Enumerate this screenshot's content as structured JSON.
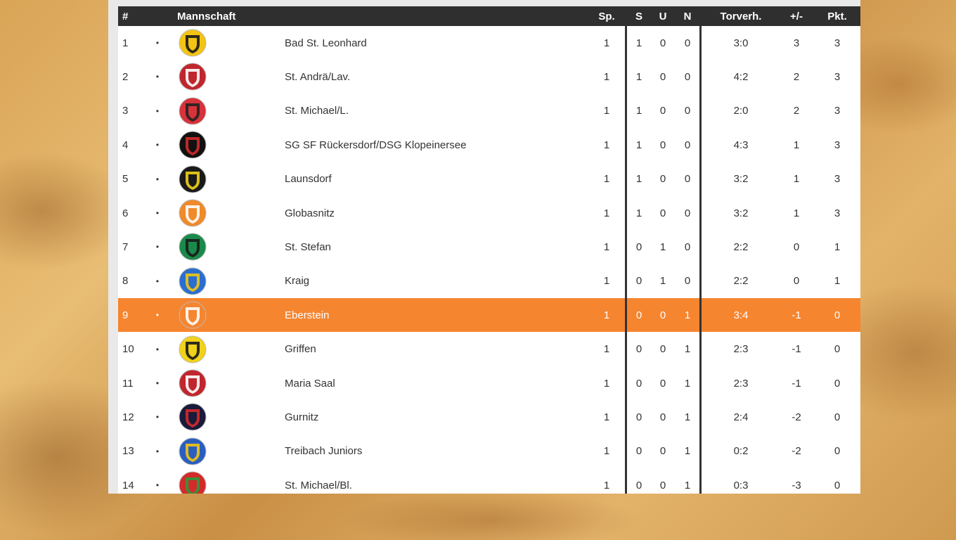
{
  "headers": {
    "pos": "#",
    "team": "Mannschaft",
    "sp": "Sp.",
    "s": "S",
    "u": "U",
    "n": "N",
    "torverh": "Torverh.",
    "diff": "+/-",
    "pkt": "Pkt."
  },
  "bullet": "•",
  "highlight_color": "#f6852f",
  "rows": [
    {
      "pos": "1",
      "team": "Bad St. Leonhard",
      "sp": "1",
      "s": "1",
      "u": "0",
      "n": "0",
      "torverh": "3:0",
      "diff": "3",
      "pkt": "3",
      "logo": "svl-crest-icon",
      "logo_colors": [
        "#f3c413",
        "#1a1a1a"
      ]
    },
    {
      "pos": "2",
      "team": "St. Andrä/Lav.",
      "sp": "1",
      "s": "1",
      "u": "0",
      "n": "0",
      "torverh": "4:2",
      "diff": "2",
      "pkt": "3",
      "logo": "sk-standrae-crest-icon",
      "logo_colors": [
        "#c0262d",
        "#ffffff"
      ]
    },
    {
      "pos": "3",
      "team": "St. Michael/L.",
      "sp": "1",
      "s": "1",
      "u": "0",
      "n": "0",
      "torverh": "2:0",
      "diff": "2",
      "pkt": "3",
      "logo": "st-michael-crest-icon",
      "logo_colors": [
        "#d8323a",
        "#222222"
      ]
    },
    {
      "pos": "4",
      "team": "SG SF Rückersdorf/DSG Klopeinersee",
      "sp": "1",
      "s": "1",
      "u": "0",
      "n": "0",
      "torverh": "4:3",
      "diff": "1",
      "pkt": "3",
      "logo": "rueckersdorf-crest-icon",
      "logo_colors": [
        "#111111",
        "#d42a2a"
      ]
    },
    {
      "pos": "5",
      "team": "Launsdorf",
      "sp": "1",
      "s": "1",
      "u": "0",
      "n": "0",
      "torverh": "3:2",
      "diff": "1",
      "pkt": "3",
      "logo": "sc-launsdorf-crest-icon",
      "logo_colors": [
        "#1a1a1a",
        "#f1d21a"
      ]
    },
    {
      "pos": "6",
      "team": "Globasnitz",
      "sp": "1",
      "s": "1",
      "u": "0",
      "n": "0",
      "torverh": "3:2",
      "diff": "1",
      "pkt": "3",
      "logo": "globasnitz-crest-icon",
      "logo_colors": [
        "#f08a2a",
        "#ffffff"
      ]
    },
    {
      "pos": "7",
      "team": "St. Stefan",
      "sp": "1",
      "s": "0",
      "u": "1",
      "n": "0",
      "torverh": "2:2",
      "diff": "0",
      "pkt": "1",
      "logo": "st-stefan-crest-icon",
      "logo_colors": [
        "#1a8a4a",
        "#1a1a1a"
      ]
    },
    {
      "pos": "8",
      "team": "Kraig",
      "sp": "1",
      "s": "0",
      "u": "1",
      "n": "0",
      "torverh": "2:2",
      "diff": "0",
      "pkt": "1",
      "logo": "kraig-crest-icon",
      "logo_colors": [
        "#2a6fd0",
        "#f3c413"
      ]
    },
    {
      "pos": "9",
      "team": "Eberstein",
      "sp": "1",
      "s": "0",
      "u": "0",
      "n": "1",
      "torverh": "3:4",
      "diff": "-1",
      "pkt": "0",
      "logo": "eberstein-crest-icon",
      "logo_colors": [
        "#f6852f",
        "#ffffff"
      ],
      "highlight": true
    },
    {
      "pos": "10",
      "team": "Griffen",
      "sp": "1",
      "s": "0",
      "u": "0",
      "n": "1",
      "torverh": "2:3",
      "diff": "-1",
      "pkt": "0",
      "logo": "griffen-crest-icon",
      "logo_colors": [
        "#f1d21a",
        "#1a1a1a"
      ]
    },
    {
      "pos": "11",
      "team": "Maria Saal",
      "sp": "1",
      "s": "0",
      "u": "0",
      "n": "1",
      "torverh": "2:3",
      "diff": "-1",
      "pkt": "0",
      "logo": "maria-saal-crest-icon",
      "logo_colors": [
        "#c0262d",
        "#ffffff"
      ]
    },
    {
      "pos": "12",
      "team": "Gurnitz",
      "sp": "1",
      "s": "0",
      "u": "0",
      "n": "1",
      "torverh": "2:4",
      "diff": "-2",
      "pkt": "0",
      "logo": "gurnitz-crest-icon",
      "logo_colors": [
        "#1a1a3a",
        "#d42a2a"
      ]
    },
    {
      "pos": "13",
      "team": "Treibach Juniors",
      "sp": "1",
      "s": "0",
      "u": "0",
      "n": "1",
      "torverh": "0:2",
      "diff": "-2",
      "pkt": "0",
      "logo": "treibach-crest-icon",
      "logo_colors": [
        "#2a5fc0",
        "#f3c413"
      ]
    },
    {
      "pos": "14",
      "team": "St. Michael/Bl.",
      "sp": "1",
      "s": "0",
      "u": "0",
      "n": "1",
      "torverh": "0:3",
      "diff": "-3",
      "pkt": "0",
      "logo": "st-michael-bl-crest-icon",
      "logo_colors": [
        "#d42a2a",
        "#2a9a3a"
      ]
    }
  ]
}
